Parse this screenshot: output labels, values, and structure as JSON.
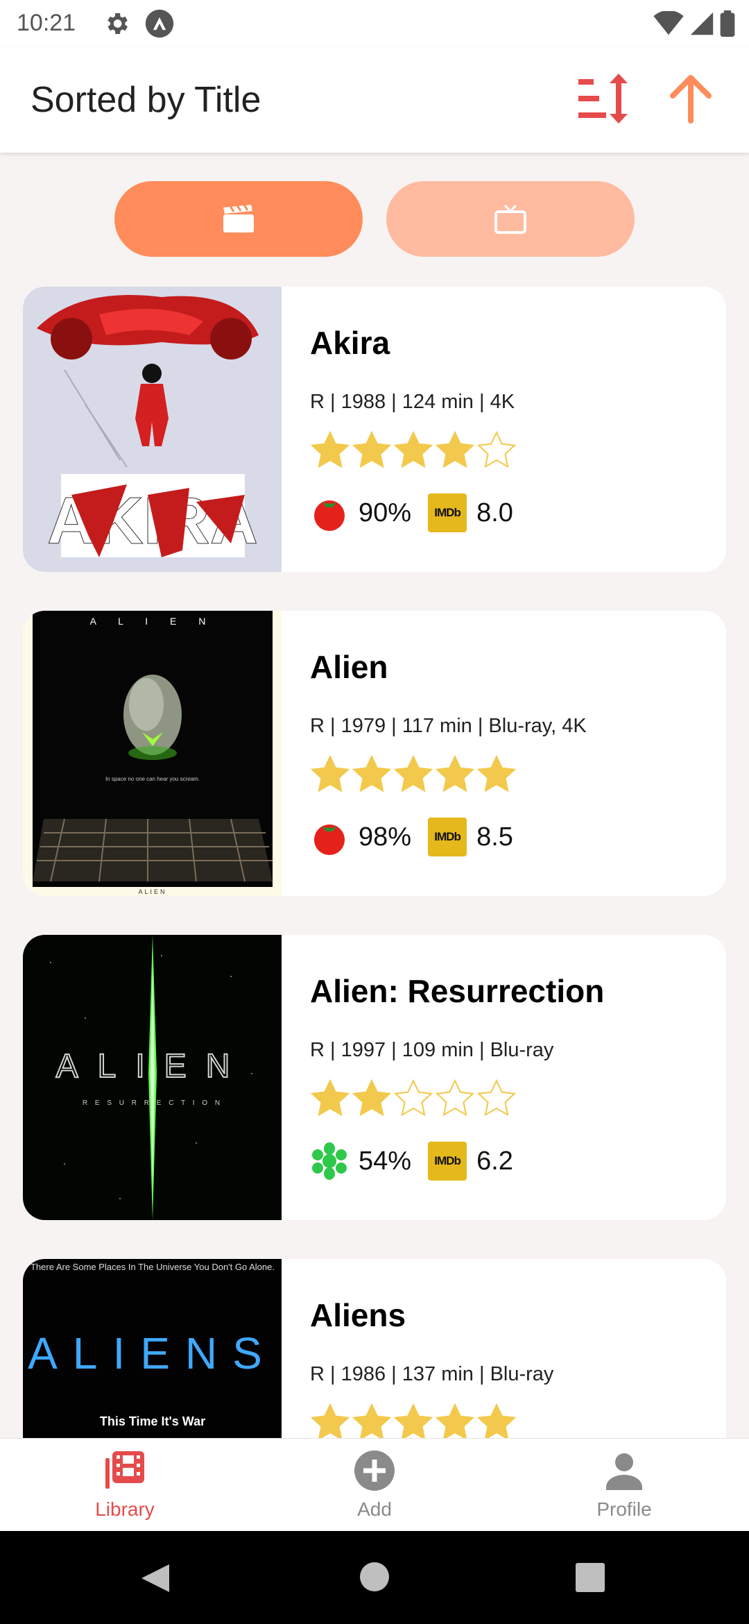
{
  "status_bar": {
    "time": "10:21"
  },
  "header": {
    "title": "Sorted by Title",
    "sort_icon": "sort-icon",
    "direction_icon": "arrow-up-icon"
  },
  "toggle": {
    "movies_icon": "clapperboard-icon",
    "tv_icon": "tv-icon",
    "active": "movies"
  },
  "colors": {
    "accent": "#ff8c5a",
    "accent_light": "#ffbba0",
    "nav_active": "#e54b4b",
    "nav_inactive": "#8a8a8a",
    "star": "#f2c94c",
    "imdb": "#e5b81c"
  },
  "movies": [
    {
      "title": "Akira",
      "meta": "R | 1988 | 124 min | 4K",
      "stars": 4,
      "rt_icon": "tomato-icon",
      "rt": "90%",
      "imdb_label": "IMDb",
      "imdb": "8.0",
      "poster_text": [
        "AKIRA"
      ]
    },
    {
      "title": "Alien",
      "meta": "R | 1979 | 117 min | Blu-ray, 4K",
      "stars": 5,
      "rt_icon": "tomato-icon",
      "rt": "98%",
      "imdb_label": "IMDb",
      "imdb": "8.5",
      "poster_text": [
        "A L I E N",
        "In space no one can hear you scream.",
        "ALIEN"
      ]
    },
    {
      "title": "Alien: Resurrection",
      "meta": "R | 1997 | 109 min | Blu-ray",
      "stars": 2,
      "rt_icon": "splat-icon",
      "rt": "54%",
      "imdb_label": "IMDb",
      "imdb": "6.2",
      "poster_text": [
        "ALIEN",
        "R E S U R R E C T I O N"
      ]
    },
    {
      "title": "Aliens",
      "meta": "R | 1986 | 137 min | Blu-ray",
      "stars": 5,
      "poster_text": [
        "There Are Some Places In The Universe You Don't Go Alone.",
        "ALIENS",
        "This Time It's War"
      ]
    }
  ],
  "nav": [
    {
      "label": "Library",
      "icon": "library-icon",
      "active": true
    },
    {
      "label": "Add",
      "icon": "add-circle-icon",
      "active": false
    },
    {
      "label": "Profile",
      "icon": "person-icon",
      "active": false
    }
  ]
}
